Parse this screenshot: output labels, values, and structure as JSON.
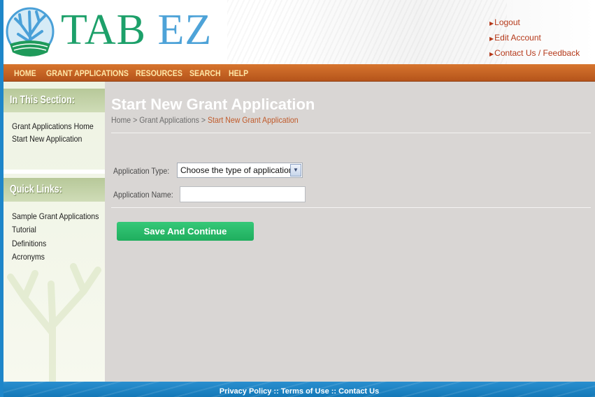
{
  "header": {
    "logo_main": "TAB",
    "logo_suffix": "EZ",
    "top_links": [
      "Logout",
      "Edit Account",
      "Contact Us / Feedback"
    ]
  },
  "nav": [
    "HOME",
    "GRANT APPLICATIONS",
    "RESOURCES",
    "SEARCH",
    "HELP"
  ],
  "sidebar": {
    "section_heading": "In This Section:",
    "section_links": [
      "Grant Applications Home",
      "Start New Application"
    ],
    "quicklinks_heading": "Quick Links:",
    "quick_links": [
      "Sample Grant Applications",
      "Tutorial",
      "Definitions",
      "Acronyms"
    ]
  },
  "main": {
    "title": "Start New Grant Application",
    "breadcrumb": {
      "home": "Home",
      "separator": " > ",
      "grant_apps": "Grant Applications",
      "current": "Start New Grant Application"
    },
    "form": {
      "app_type_label": "Application Type:",
      "app_type_value": "Choose the type of application",
      "app_name_label": "Application Name:",
      "app_name_value": ""
    },
    "save_label": "Save And Continue"
  },
  "footer": {
    "links": [
      "Privacy Policy",
      "Terms of Use",
      "Contact Us"
    ],
    "separator": " :: "
  },
  "colors": {
    "accent_nav": "#c8621f",
    "nav_text": "#ffe7a8",
    "button_green": "#2bbb6b",
    "link_red": "#b5391a",
    "frame_blue": "#1e86c9",
    "content_gray": "#d9d6d4"
  }
}
